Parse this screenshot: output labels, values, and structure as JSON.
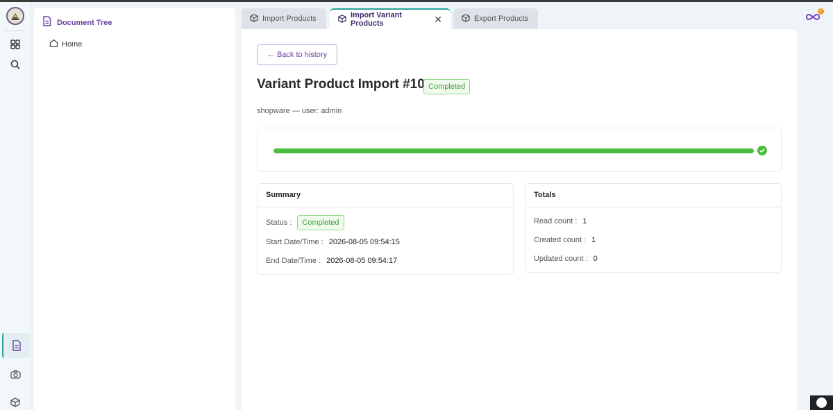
{
  "rail": {
    "icons": [
      "app-logo",
      "grid-icon",
      "search-icon",
      "document-icon",
      "camera-icon",
      "cube-icon"
    ]
  },
  "tree": {
    "title": "Document Tree",
    "items": [
      {
        "label": "Home"
      }
    ]
  },
  "tabs": [
    {
      "label": "Import Products",
      "active": false
    },
    {
      "label": "Import Variant Products",
      "active": true
    },
    {
      "label": "Export Products",
      "active": false
    }
  ],
  "page": {
    "back_label": "← Back to history",
    "title": "Variant Product Import #10",
    "status_badge": "Completed",
    "subtitle": "shopware — user: admin",
    "progress_fraction": 1.0
  },
  "summary": {
    "title": "Summary",
    "status_label": "Status :",
    "status_value": "Completed",
    "start_label": "Start Date/Time :",
    "start_value": "2026-08-05 09:54:15",
    "end_label": "End Date/Time :",
    "end_value": "2026-08-05 09:54:17"
  },
  "totals": {
    "title": "Totals",
    "read_label": "Read count :",
    "read_value": "1",
    "created_label": "Created count :",
    "created_value": "1",
    "updated_label": "Updated count :",
    "updated_value": "0"
  },
  "colors": {
    "accent": "#6b3fa0",
    "teal": "#2aa198",
    "success": "#4cbc3f",
    "notification": "#f39c12"
  }
}
